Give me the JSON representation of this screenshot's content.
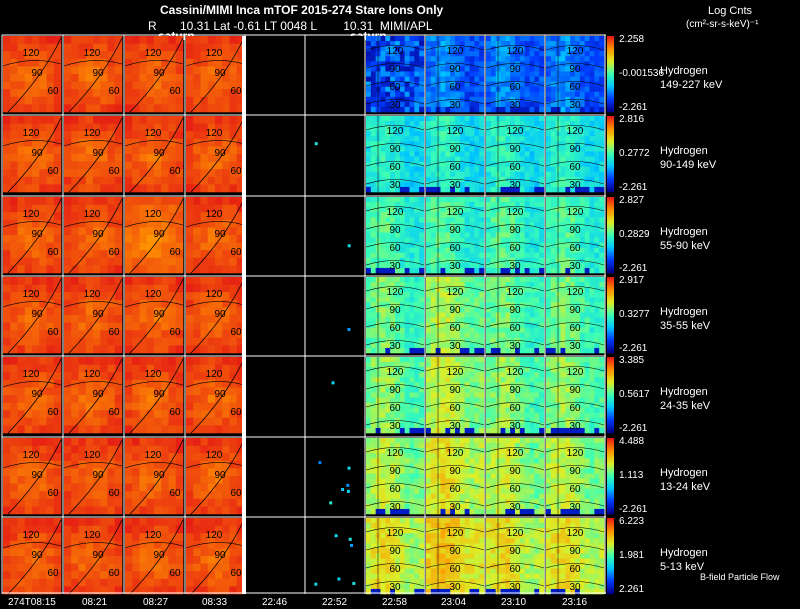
{
  "header": {
    "title": "Cassini/MIMI Inca mTOF  2015-274   Stare    Ions Only",
    "line2_prefix": "R       10.31 Lat -0.61 LT 0048 L        10.31  MIMI/APL",
    "units_1": "Log Cnts",
    "units_2": "(cm²-sr-s-keV)⁻¹",
    "saturn_left": "saturn",
    "saturn_right": "saturn",
    "flow_label": "B-field Particle Flow"
  },
  "time_ticks": [
    "274T08:15",
    "08:21",
    "08:27",
    "08:33",
    "22:46",
    "22:52",
    "22:58",
    "23:04",
    "23:10",
    "23:16"
  ],
  "rows": [
    {
      "species": "Hydrogen",
      "energy": "149-227 keV",
      "cb_max": "2.258",
      "cb_mid": "-0.001536",
      "cb_min": "-2.261"
    },
    {
      "species": "Hydrogen",
      "energy": "90-149 keV",
      "cb_max": "2.816",
      "cb_mid": "0.2772",
      "cb_min": "-2.261"
    },
    {
      "species": "Hydrogen",
      "energy": "55-90 keV",
      "cb_max": "2.827",
      "cb_mid": "0.2829",
      "cb_min": "-2.261"
    },
    {
      "species": "Hydrogen",
      "energy": "35-55 keV",
      "cb_max": "2.917",
      "cb_mid": "0.3277",
      "cb_min": "-2.261"
    },
    {
      "species": "Hydrogen",
      "energy": "24-35 keV",
      "cb_max": "3.385",
      "cb_mid": "0.5617",
      "cb_min": "-2.261"
    },
    {
      "species": "Hydrogen",
      "energy": "13-24 keV",
      "cb_max": "4.488",
      "cb_mid": "1.113",
      "cb_min": "-2.261"
    },
    {
      "species": "Hydrogen",
      "energy": "5-13 keV",
      "cb_max": "6.223",
      "cb_mid": "1.981",
      "cb_min": "2.261"
    }
  ],
  "grid_labels": [
    "120",
    "90",
    "60",
    "30"
  ],
  "colors": {
    "left_panels": "#e8361e",
    "right_panels_high": "#f5e030",
    "right_panels_low": "#1040e0",
    "grid": "#ffffff"
  },
  "chart_data": {
    "type": "heatmap",
    "title": "Cassini/MIMI Inca mTOF  2015-274   Stare    Ions Only",
    "colorbar_label": "Log Cnts (cm²-sr-s-keV)⁻¹",
    "colormap": "rainbow",
    "x_ticks": [
      "274T08:15",
      "08:21",
      "08:27",
      "08:33",
      "22:46",
      "22:52",
      "22:58",
      "23:04",
      "23:10",
      "23:16"
    ],
    "series": [
      {
        "name": "Hydrogen 149-227 keV",
        "colorbar_range": [
          -2.261,
          2.258
        ]
      },
      {
        "name": "Hydrogen 90-149 keV",
        "colorbar_range": [
          -2.261,
          2.816
        ]
      },
      {
        "name": "Hydrogen 55-90 keV",
        "colorbar_range": [
          -2.261,
          2.827
        ]
      },
      {
        "name": "Hydrogen 35-55 keV",
        "colorbar_range": [
          -2.261,
          2.917
        ]
      },
      {
        "name": "Hydrogen 24-35 keV",
        "colorbar_range": [
          -2.261,
          3.385
        ]
      },
      {
        "name": "Hydrogen 13-24 keV",
        "colorbar_range": [
          -2.261,
          4.488
        ]
      },
      {
        "name": "Hydrogen 5-13 keV",
        "colorbar_range": [
          2.261,
          6.223
        ]
      }
    ]
  }
}
